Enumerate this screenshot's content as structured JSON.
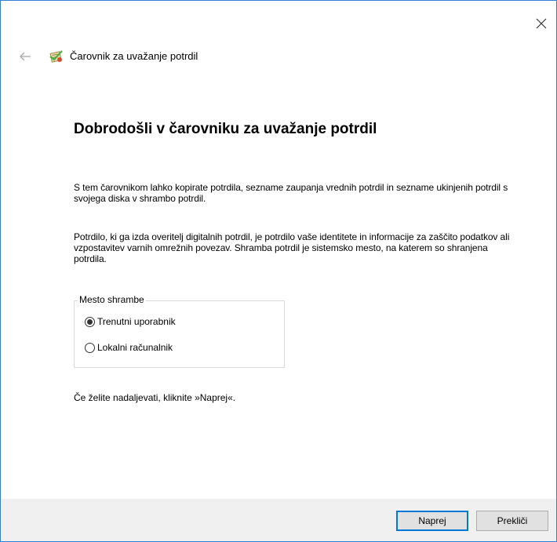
{
  "window": {
    "title": "Čarovnik za uvažanje potrdil",
    "close_icon": "close-icon",
    "back_icon": "back-arrow-icon",
    "app_icon": "certificate-icon"
  },
  "main": {
    "heading": "Dobrodošli v čarovniku za uvažanje potrdil",
    "paragraph1": "S tem čarovnikom lahko kopirate potrdila, sezname zaupanja vrednih potrdil in sezname ukinjenih potrdil s svojega diska v shrambo potrdil.",
    "paragraph2": "Potrdilo, ki ga izda overitelj digitalnih potrdil, je potrdilo vaše identitete in informacije za zaščito podatkov ali vzpostavitev varnih omrežnih povezav. Shramba potrdil je sistemsko mesto, na katerem so shranjena potrdila.",
    "store_location": {
      "legend": "Mesto shrambe",
      "options": [
        {
          "label": "Trenutni uporabnik",
          "selected": true
        },
        {
          "label": "Lokalni računalnik",
          "selected": false
        }
      ]
    },
    "continue_text": "Če želite nadaljevati, kliknite »Naprej«."
  },
  "footer": {
    "next_label": "Naprej",
    "cancel_label": "Prekliči"
  },
  "colors": {
    "accent": "#0078d7",
    "footer_bg": "#f0f0f0"
  }
}
